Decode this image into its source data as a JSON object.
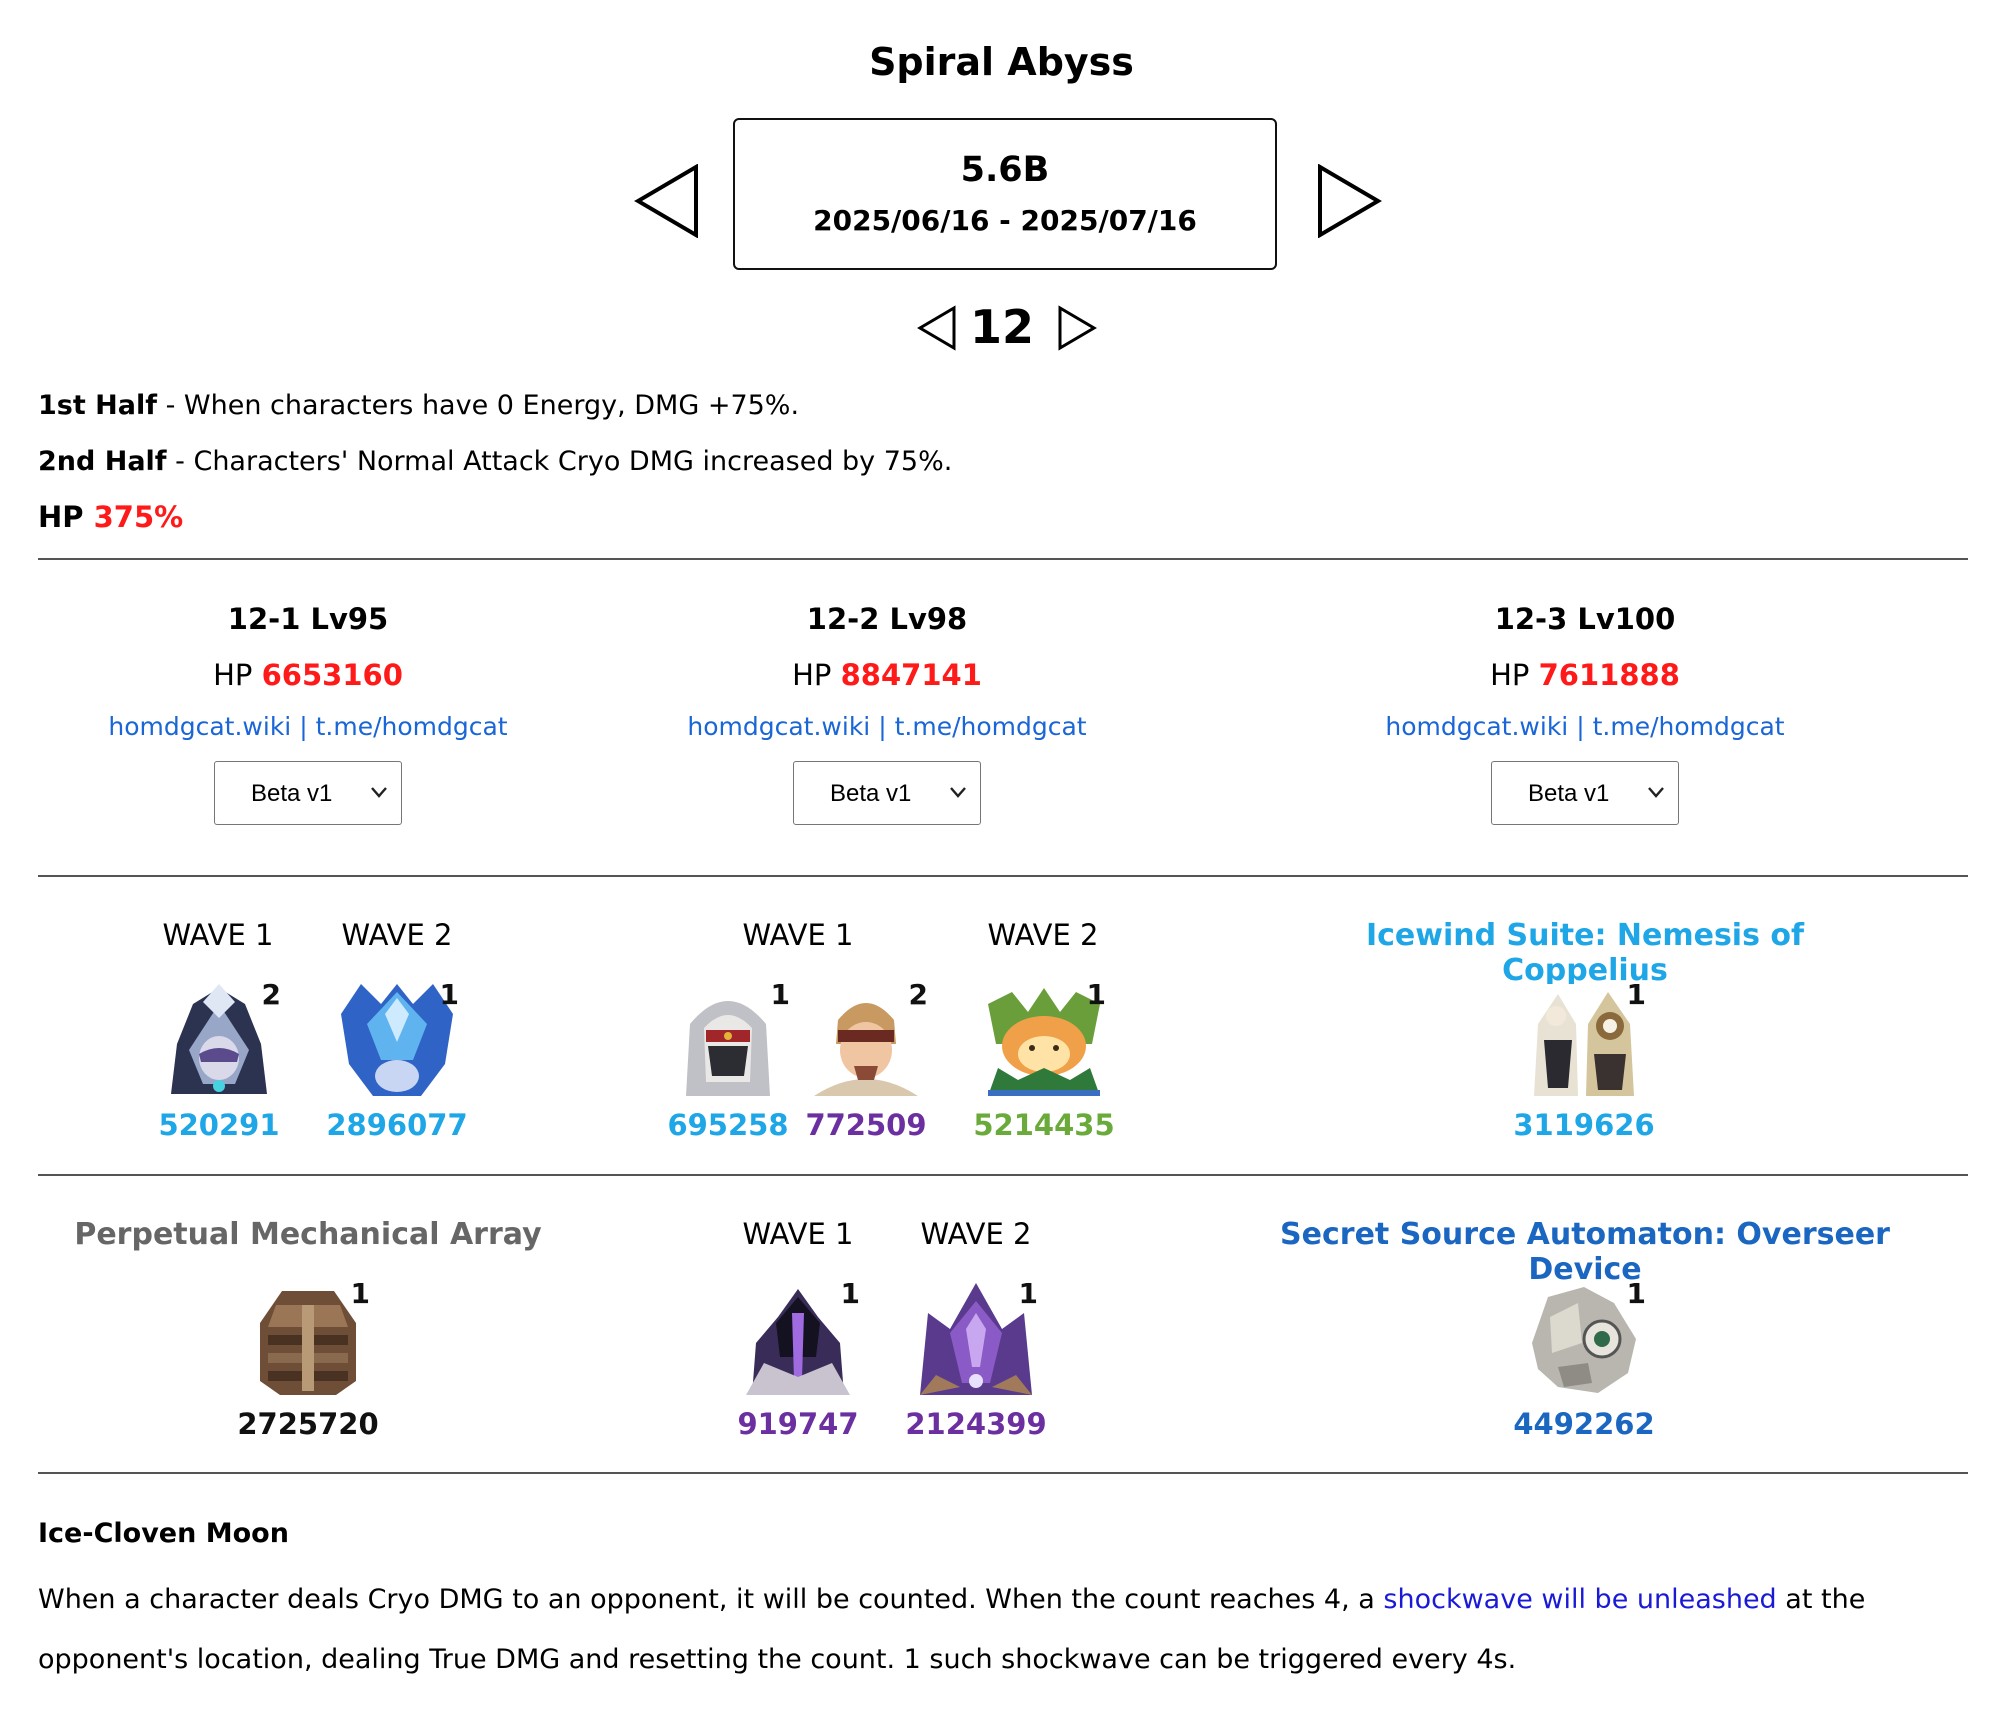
{
  "page": {
    "title": "Spiral Abyss",
    "period": {
      "version": "5.6B",
      "dates": "2025/06/16 - 2025/07/16"
    },
    "floor": "12"
  },
  "halves": [
    {
      "label": "1st Half",
      "text": " - When characters have 0 Energy, DMG +75%."
    },
    {
      "label": "2nd Half",
      "text": " - Characters' Normal Attack Cryo DMG increased by 75%."
    }
  ],
  "hp": {
    "label": "HP ",
    "value": "375%"
  },
  "chambers": [
    {
      "title": "12-1 Lv95",
      "hp_label": "HP ",
      "hp_value": "6653160",
      "link1": "homdgcat.wiki",
      "sep": " | ",
      "link2": "t.me/homdgcat",
      "version": "Beta v1"
    },
    {
      "title": "12-2 Lv98",
      "hp_label": "HP ",
      "hp_value": "8847141",
      "link1": "homdgcat.wiki",
      "sep": " | ",
      "link2": "t.me/homdgcat",
      "version": "Beta v1"
    },
    {
      "title": "12-3 Lv100",
      "hp_label": "HP ",
      "hp_value": "7611888",
      "link1": "homdgcat.wiki",
      "sep": " | ",
      "link2": "t.me/homdgcat",
      "version": "Beta v1"
    }
  ],
  "first_half": {
    "c1": {
      "wave1": "WAVE 1",
      "wave2": "WAVE 2",
      "e1": {
        "count": "2",
        "hp": "520291",
        "color": "#1ea6e6",
        "icon": "abyss-herald-icon"
      },
      "e2": {
        "count": "1",
        "hp": "2896077",
        "color": "#1ea6e6",
        "icon": "hydro-tulpa-icon"
      }
    },
    "c2": {
      "wave1": "WAVE 1",
      "wave2": "WAVE 2",
      "e1": {
        "count": "1",
        "hp": "695258",
        "color": "#1ea6e6",
        "icon": "eremite-hood-icon"
      },
      "e2": {
        "count": "2",
        "hp": "772509",
        "color": "#6b2fa0",
        "icon": "eremite-blindfold-icon"
      },
      "e3": {
        "count": "1",
        "hp": "5214435",
        "color": "#6aaa3a",
        "icon": "dendro-creature-icon"
      }
    },
    "c3": {
      "boss": "Icewind Suite: Nemesis of Coppelius",
      "boss_color": "#1ea6e6",
      "e1": {
        "count": "1",
        "hp": "3119626",
        "color": "#1ea6e6",
        "icon": "icewind-suite-icon"
      }
    }
  },
  "second_half": {
    "c1": {
      "boss": "Perpetual Mechanical Array",
      "boss_color": "#666666",
      "e1": {
        "count": "1",
        "hp": "2725720",
        "color": "#111111",
        "icon": "mechanical-array-icon"
      }
    },
    "c2": {
      "wave1": "WAVE 1",
      "wave2": "WAVE 2",
      "e1": {
        "count": "1",
        "hp": "919747",
        "color": "#6b2fa0",
        "icon": "dark-knight-icon"
      },
      "e2": {
        "count": "1",
        "hp": "2124399",
        "color": "#6b2fa0",
        "icon": "wolf-lord-icon"
      }
    },
    "c3": {
      "boss": "Secret Source Automaton: Overseer Device",
      "boss_color": "#1a66c0",
      "e1": {
        "count": "1",
        "hp": "4492262",
        "color": "#1a66c0",
        "icon": "overseer-device-icon"
      }
    }
  },
  "blessing": {
    "title": "Ice-Cloven Moon",
    "text_before": "When a character deals Cryo DMG to an opponent, it will be counted. When the count reaches 4, a ",
    "link": "shockwave will be unleashed",
    "text_after": " at the opponent's location, dealing True DMG and resetting the count. 1 such shockwave can be triggered every 4s."
  }
}
